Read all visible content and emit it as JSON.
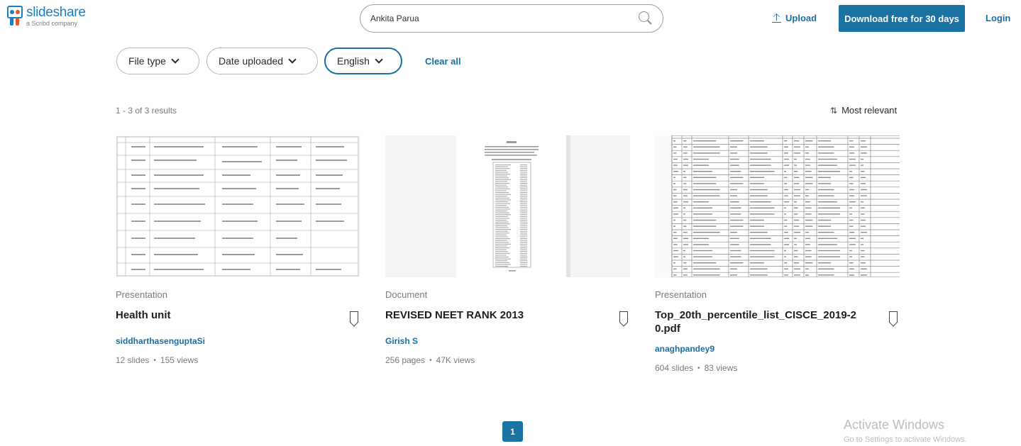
{
  "header": {
    "logo_name": "slideshare",
    "logo_sub": "a Scribd company",
    "search_value": "Ankita Parua",
    "upload_label": "Upload",
    "download_label": "Download free for 30 days",
    "login_label": "Login"
  },
  "filters": {
    "items": [
      {
        "label": "File type"
      },
      {
        "label": "Date uploaded"
      },
      {
        "label": "English"
      }
    ],
    "clear_label": "Clear all"
  },
  "results": {
    "count_text": "1 - 3 of 3 results",
    "sort_label": "Most relevant",
    "cards": [
      {
        "type": "Presentation",
        "title": "Health unit",
        "author": "siddharthasenguptaSi",
        "count": "12 slides",
        "views": "155 views"
      },
      {
        "type": "Document",
        "title": "REVISED NEET RANK 2013",
        "author": "Girish S",
        "count": "256 pages",
        "views": "47K views"
      },
      {
        "type": "Presentation",
        "title": "Top_20th_percentile_list_CISCE_2019-20.pdf",
        "author": "anaghpandey9",
        "count": "604 slides",
        "views": "83 views"
      }
    ]
  },
  "pagination": {
    "current": "1"
  },
  "watermark": {
    "title": "Activate Windows",
    "subtitle": "Go to Settings to activate Windows."
  },
  "colors": {
    "accent": "#1a73a3",
    "link": "#1a6ea3",
    "brand_orange": "#e8552b"
  },
  "icons": [
    "slideshare-logo",
    "search-icon",
    "upload-icon",
    "chevron-down-icon",
    "sort-icon",
    "bookmark-icon"
  ]
}
